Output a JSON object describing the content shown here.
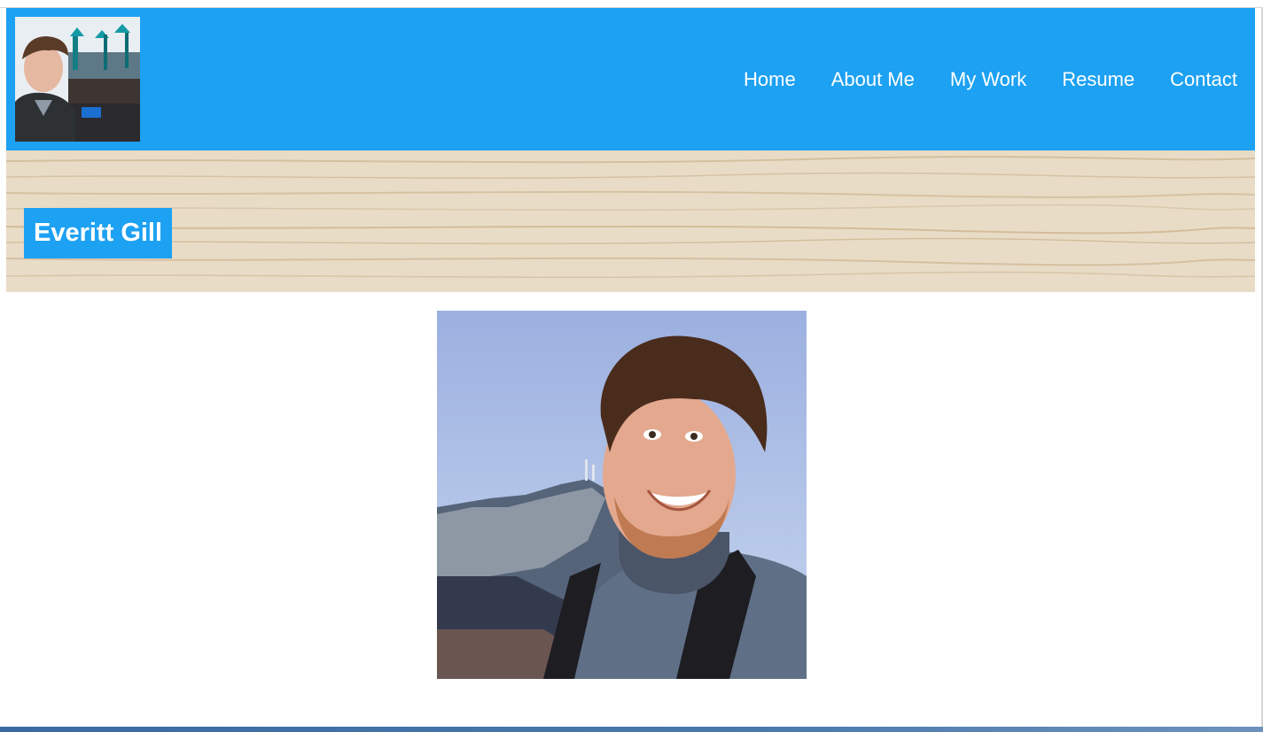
{
  "header": {
    "avatar_alt": "Profile photo of Everitt Gill",
    "nav": [
      "Home",
      "About Me",
      "My Work",
      "Resume",
      "Contact"
    ]
  },
  "banner": {
    "title": "Everitt Gill"
  },
  "main": {
    "photo_alt": "Smiling selfie in front of a mountain"
  },
  "colors": {
    "accent": "#1da1f2",
    "banner_wood": "#e6d8c2",
    "footer": "#3a6aa0"
  }
}
